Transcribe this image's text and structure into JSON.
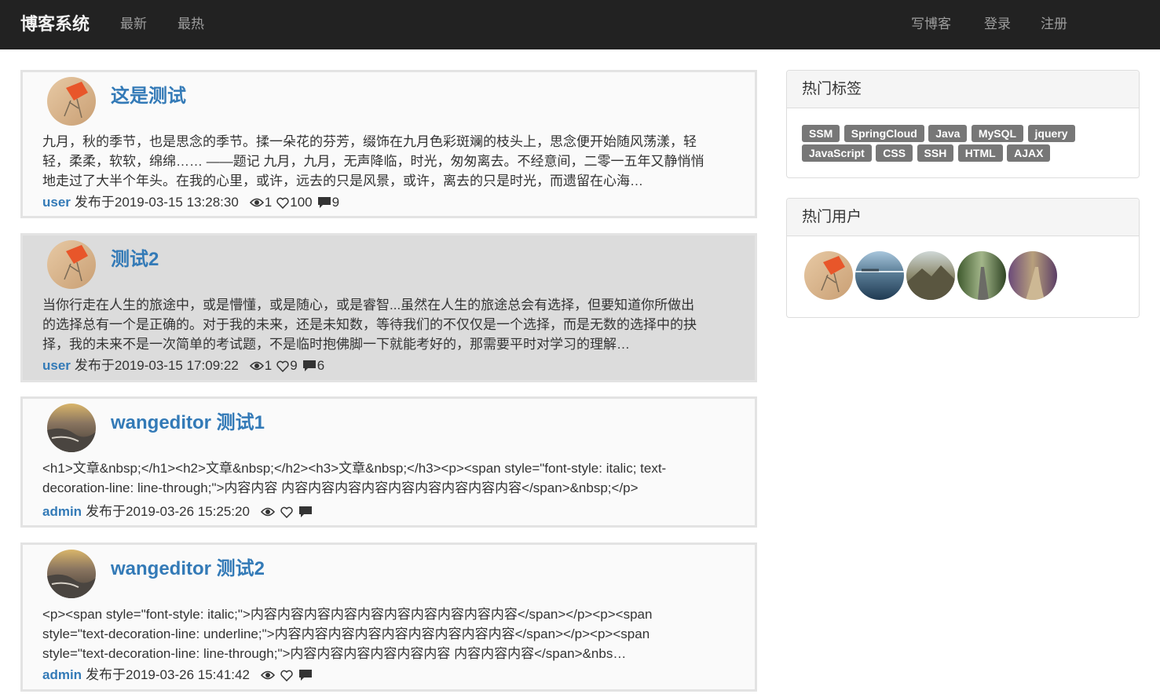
{
  "navbar": {
    "brand": "博客系统",
    "left_links": [
      "最新",
      "最热"
    ],
    "right_links": [
      "写博客",
      "登录",
      "注册"
    ]
  },
  "posts": [
    {
      "title": "这是测试",
      "body": "九月，秋的季节，也是思念的季节。揉一朵花的芬芳，缀饰在九月色彩斑斓的枝头上，思念便开始随风荡漾，轻轻，柔柔，软软，绵绵…… ——题记 九月，九月，无声降临，时光，匆匆离去。不经意间，二零一五年又静悄悄地走过了大半个年头。在我的心里，或许，远去的只是风景，或许，离去的只是时光，而遗留在心海…",
      "user": "user",
      "published": "发布于2019-03-15 13:28:30",
      "views": "1",
      "likes": "100",
      "comments": "9",
      "avatar": "chair"
    },
    {
      "title": "测试2",
      "body": "当你行走在人生的旅途中，或是懵懂，或是随心，或是睿智...虽然在人生的旅途总会有选择，但要知道你所做出的选择总有一个是正确的。对于我的未来，还是未知数，等待我们的不仅仅是一个选择，而是无数的选择中的抉择，我的未来不是一次简单的考试题，不是临时抱佛脚一下就能考好的，那需要平时对学习的理解…",
      "user": "user",
      "published": "发布于2019-03-15 17:09:22",
      "views": "1",
      "likes": "9",
      "comments": "6",
      "avatar": "chair"
    },
    {
      "title": "wangeditor 测试1",
      "body": "<h1>文章&nbsp;</h1><h2>文章&nbsp;</h2><h3>文章&nbsp;</h3><p><span style=\"font-style: italic; text-decoration-line: line-through;\">内容内容 内容内容内容内容内容内容内容内容内容</span>&nbsp;</p>",
      "user": "admin",
      "published": "发布于2019-03-26 15:25:20",
      "views": "",
      "likes": "",
      "comments": "",
      "avatar": "beach"
    },
    {
      "title": "wangeditor 测试2",
      "body": "<p><span style=\"font-style: italic;\">内容内容内容内容内容内容内容内容内容内容</span></p><p><span style=\"text-decoration-line: underline;\">内容内容内容内容内容内容内容内容内容</span></p><p><span style=\"text-decoration-line: line-through;\">内容内容内容内容内容内容 内容内容内容</span>&nbs…",
      "user": "admin",
      "published": "发布于2019-03-26 15:41:42",
      "views": "",
      "likes": "",
      "comments": "",
      "avatar": "beach"
    }
  ],
  "sidebar": {
    "tags_title": "热门标签",
    "tags": [
      "SSM",
      "SpringCloud",
      "Java",
      "MySQL",
      "jquery",
      "JavaScript",
      "CSS",
      "SSH",
      "HTML",
      "AJAX"
    ],
    "users_title": "热门用户",
    "users": [
      "chair",
      "sea",
      "mountain",
      "street",
      "forest"
    ]
  },
  "colors": {
    "navbar_bg": "#222222",
    "link": "#337ab7",
    "tag_bg": "#777777",
    "hover_post_bg": "#dcdcdc"
  }
}
